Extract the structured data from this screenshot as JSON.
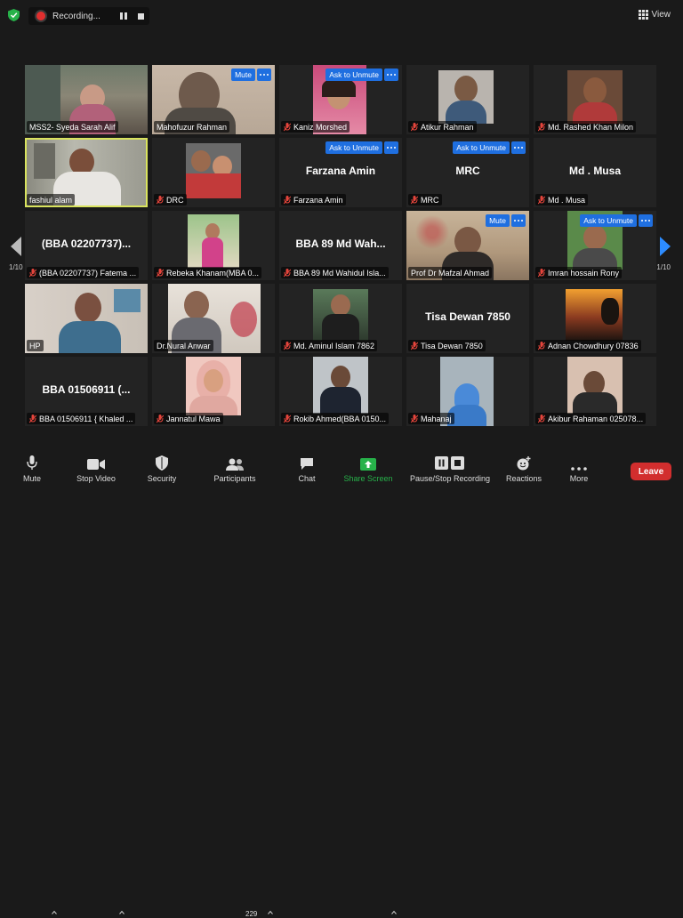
{
  "top_bar": {
    "recording_label": "Recording...",
    "view_label": "View"
  },
  "gallery": {
    "page_left": "1/10",
    "page_right": "1/10",
    "tiles": [
      {
        "name": "MSS2- Syeda Sarah Alif",
        "muted": false
      },
      {
        "name": "Mahofuzur Rahman",
        "muted": false,
        "button": "Mute"
      },
      {
        "name": "Kaniz Morshed",
        "muted": true,
        "button": "Ask to Unmute"
      },
      {
        "name": "Atikur Rahman",
        "muted": true
      },
      {
        "name": "Md. Rashed Khan Milon",
        "muted": true
      },
      {
        "name": "fashiul alam",
        "muted": false
      },
      {
        "name": "DRC",
        "muted": true
      },
      {
        "name": "Farzana Amin",
        "muted": true,
        "display": "Farzana Amin",
        "button": "Ask to Unmute"
      },
      {
        "name": "MRC",
        "muted": true,
        "display": "MRC",
        "button": "Ask to Unmute"
      },
      {
        "name": "Md . Musa",
        "muted": true,
        "display": "Md . Musa"
      },
      {
        "name": "(BBA 02207737) Fatema ...",
        "muted": true,
        "display": "(BBA 02207737)..."
      },
      {
        "name": "Rebeka Khanam(MBA 0...",
        "muted": true
      },
      {
        "name": "BBA 89 Md Wahidul Isla...",
        "muted": true,
        "display": "BBA 89 Md Wah..."
      },
      {
        "name": "Prof Dr Mafzal Ahmad",
        "muted": false,
        "button": "Mute"
      },
      {
        "name": "Imran hossain Rony",
        "muted": true,
        "button": "Ask to Unmute"
      },
      {
        "name": "HP",
        "muted": false
      },
      {
        "name": "Dr.Nural Anwar",
        "muted": false
      },
      {
        "name": "Md. Aminul Islam 7862",
        "muted": true
      },
      {
        "name": "Tisa Dewan 7850",
        "muted": true,
        "display": "Tisa Dewan 7850"
      },
      {
        "name": "Adnan Chowdhury 07836",
        "muted": true
      },
      {
        "name": "BBA 01506911 { Khaled ...",
        "muted": true,
        "display": "BBA 01506911 (..."
      },
      {
        "name": "Jannatul Mawa",
        "muted": true
      },
      {
        "name": "Rokib Ahmed(BBA 0150...",
        "muted": true
      },
      {
        "name": "Mahanaj",
        "muted": true
      },
      {
        "name": "Akibur Rahaman 025078...",
        "muted": true
      }
    ]
  },
  "toolbar": {
    "mute": "Mute",
    "stop_video": "Stop Video",
    "security": "Security",
    "participants": "Participants",
    "participants_count": "229",
    "chat": "Chat",
    "share_screen": "Share Screen",
    "pause_stop_recording": "Pause/Stop Recording",
    "reactions": "Reactions",
    "more": "More",
    "leave": "Leave"
  },
  "colors": {
    "share_screen": "#27b24a",
    "leave": "#d22e2e",
    "active_speaker": "#d9e35e",
    "button_blue": "#1f6fe0"
  }
}
